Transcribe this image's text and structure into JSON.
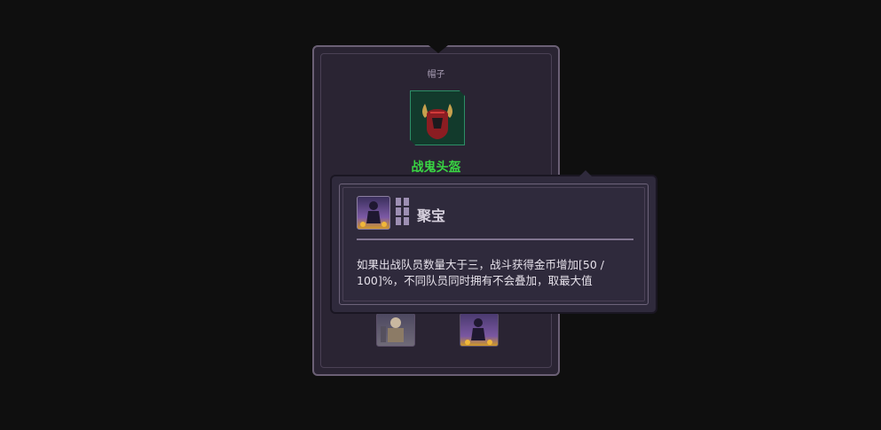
{
  "item_card": {
    "slot_label": "帽子",
    "item_name": "战鬼头盔",
    "item_icon": "horned-helmet-icon",
    "colors": {
      "item_name": "#39d443",
      "icon_bg": "#123a2c",
      "card_bg": "#2a2433"
    },
    "members": [
      {
        "icon": "warrior-portrait-icon"
      },
      {
        "icon": "treasure-mage-portrait-icon"
      }
    ]
  },
  "tooltip": {
    "skill_icon": "treasure-mage-portrait-icon",
    "rank_icon": "rank-bars-icon",
    "skill_name": "聚宝",
    "description": "如果出战队员数量大于三，战斗获得金币增加[50 / 100]%，不同队员同时拥有不会叠加，取最大值"
  }
}
